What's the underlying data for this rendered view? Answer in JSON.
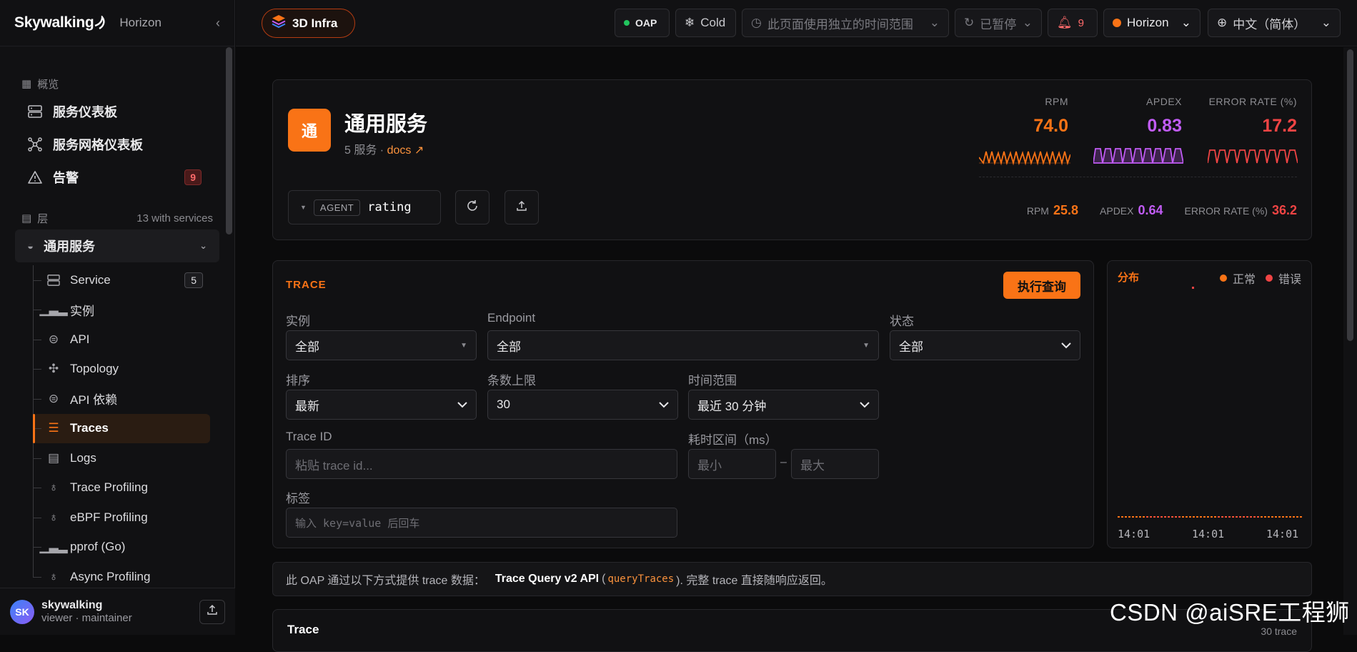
{
  "sidebar": {
    "logo": "Skywalking",
    "product": "Horizon",
    "overview_section": "概览",
    "top_items": [
      {
        "label": "服务仪表板"
      },
      {
        "label": "服务网格仪表板"
      },
      {
        "label": "告警",
        "badge": "9"
      }
    ],
    "layer_section": "层",
    "layer_count": "13 with services",
    "group_label": "通用服务",
    "sub_items": [
      {
        "label": "Service",
        "count": "5"
      },
      {
        "label": "实例"
      },
      {
        "label": "API"
      },
      {
        "label": "Topology"
      },
      {
        "label": "API 依赖"
      },
      {
        "label": "Traces"
      },
      {
        "label": "Logs"
      },
      {
        "label": "Trace Profiling"
      },
      {
        "label": "eBPF Profiling"
      },
      {
        "label": "pprof (Go)"
      },
      {
        "label": "Async Profiling"
      }
    ],
    "user": {
      "initials": "SK",
      "name": "skywalking",
      "role": "viewer · maintainer"
    }
  },
  "topbar": {
    "infra_label": "3D Infra",
    "oap_label": "OAP",
    "cold_label": "Cold",
    "time_range_note": "此页面使用独立的时间范围",
    "paused_label": "已暂停",
    "alert_count": "9",
    "horizon_label": "Horizon",
    "language_label": "中文（简体）"
  },
  "service": {
    "icon_char": "通",
    "title": "通用服务",
    "subtitle": "5 服务 ·",
    "docs_link": "docs ↗",
    "metrics": [
      {
        "label": "RPM",
        "value": "74.0",
        "color": "#f97316"
      },
      {
        "label": "APDEX",
        "value": "0.83",
        "color": "#c15cf5"
      },
      {
        "label": "ERROR RATE (%)",
        "value": "17.2",
        "color": "#f04444"
      }
    ],
    "agent_tag": "AGENT",
    "agent_name": "rating",
    "sub_metrics": [
      {
        "label": "RPM",
        "value": "25.8",
        "color": "#f97316"
      },
      {
        "label": "APDEX",
        "value": "0.64",
        "color": "#c15cf5"
      },
      {
        "label": "ERROR RATE (%)",
        "value": "36.2",
        "color": "#f04444"
      }
    ]
  },
  "trace_form": {
    "section_label": "TRACE",
    "run_button": "执行查询",
    "instance_label": "实例",
    "instance_value": "全部",
    "endpoint_label": "Endpoint",
    "endpoint_value": "全部",
    "status_label": "状态",
    "status_value": "全部",
    "sort_label": "排序",
    "sort_value": "最新",
    "limit_label": "条数上限",
    "limit_value": "30",
    "range_label": "时间范围",
    "range_value": "最近 30 分钟",
    "traceid_label": "Trace ID",
    "traceid_placeholder": "粘贴 trace id...",
    "duration_label": "耗时区间（ms）",
    "min_placeholder": "最小",
    "duration_dash": "–",
    "max_placeholder": "最大",
    "tags_label": "标签",
    "tags_placeholder": "输入 key=value 后回车"
  },
  "distribution": {
    "title": "分布",
    "legend_ok": "正常",
    "legend_err": "错误",
    "ticks": [
      "14:01",
      "14:01",
      "14:01"
    ]
  },
  "info": {
    "text1": "此 OAP 通过以下方式提供 trace 数据：",
    "api_name": "Trace Query v2 API",
    "open_paren": "(",
    "code": "queryTraces",
    "text2": "). 完整 trace 直接随响应返回。"
  },
  "trace_list": {
    "title": "Trace",
    "count": "30 trace"
  },
  "watermark": "CSDN @aiSRE工程狮",
  "colors": {
    "accent": "#f97316",
    "apdex": "#c15cf5",
    "error": "#f04444"
  }
}
